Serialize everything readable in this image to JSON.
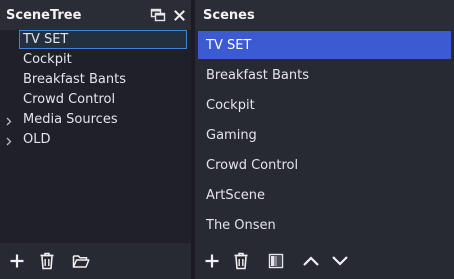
{
  "colors": {
    "background": "#1d1e26",
    "panel": "#272a33",
    "titlebar": "#2a2d36",
    "tree_list_bg": "#1f2029",
    "selection_blue": "#3c5ad2",
    "tree_selection_border": "#3f84d8",
    "text": "#e4e4ea"
  },
  "scene_tree": {
    "title": "SceneTree",
    "items": [
      {
        "label": "TV SET",
        "selected": true,
        "expandable": false
      },
      {
        "label": "Cockpit",
        "selected": false,
        "expandable": false
      },
      {
        "label": "Breakfast Bants",
        "selected": false,
        "expandable": false
      },
      {
        "label": "Crowd Control",
        "selected": false,
        "expandable": false
      },
      {
        "label": "Media Sources",
        "selected": false,
        "expandable": true
      },
      {
        "label": "OLD",
        "selected": false,
        "expandable": true
      }
    ],
    "toolbar_icons": [
      "plus-icon",
      "trash-icon",
      "folder-open-icon"
    ],
    "title_icons": [
      "float-window-icon",
      "close-icon"
    ]
  },
  "scenes": {
    "title": "Scenes",
    "items": [
      {
        "label": "TV SET",
        "selected": true
      },
      {
        "label": "Breakfast Bants",
        "selected": false
      },
      {
        "label": "Cockpit",
        "selected": false
      },
      {
        "label": "Gaming",
        "selected": false
      },
      {
        "label": "Crowd Control",
        "selected": false
      },
      {
        "label": "ArtScene",
        "selected": false
      },
      {
        "label": "The Onsen",
        "selected": false
      }
    ],
    "toolbar_icons": [
      "plus-icon",
      "trash-icon",
      "filter-icon",
      "move-up-icon",
      "move-down-icon"
    ]
  }
}
